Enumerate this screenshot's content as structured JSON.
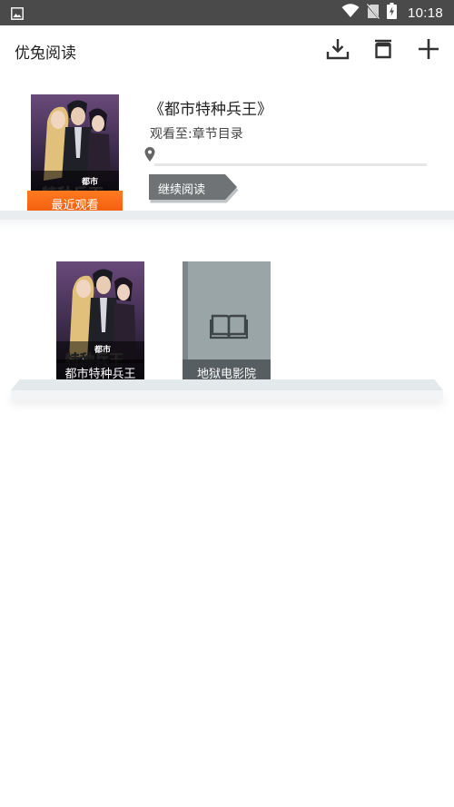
{
  "status_bar": {
    "time": "10:18",
    "icons": [
      "gallery-icon",
      "wifi-icon",
      "no-sim-icon",
      "battery-charging-icon"
    ]
  },
  "app_bar": {
    "title": "优兔阅读",
    "actions": [
      "download-icon",
      "archive-icon",
      "add-icon"
    ]
  },
  "recent": {
    "book_title": "《都市特种兵王》",
    "progress_text": "观看至:章节目录",
    "progress_fraction": 0.0,
    "badge": "最近观看",
    "continue_label": "继续阅读",
    "cover_text": "都市特种兵王"
  },
  "shelf": {
    "books": [
      {
        "title": "都市特种兵王",
        "cover": "illustrated"
      },
      {
        "title": "地狱电影院",
        "cover": "placeholder-book-icon"
      }
    ]
  },
  "colors": {
    "status_bar": "#4a4a4a",
    "badge": "#f26511",
    "continue_button": "#6f7375",
    "placeholder_cover": "#9aa5a8"
  }
}
